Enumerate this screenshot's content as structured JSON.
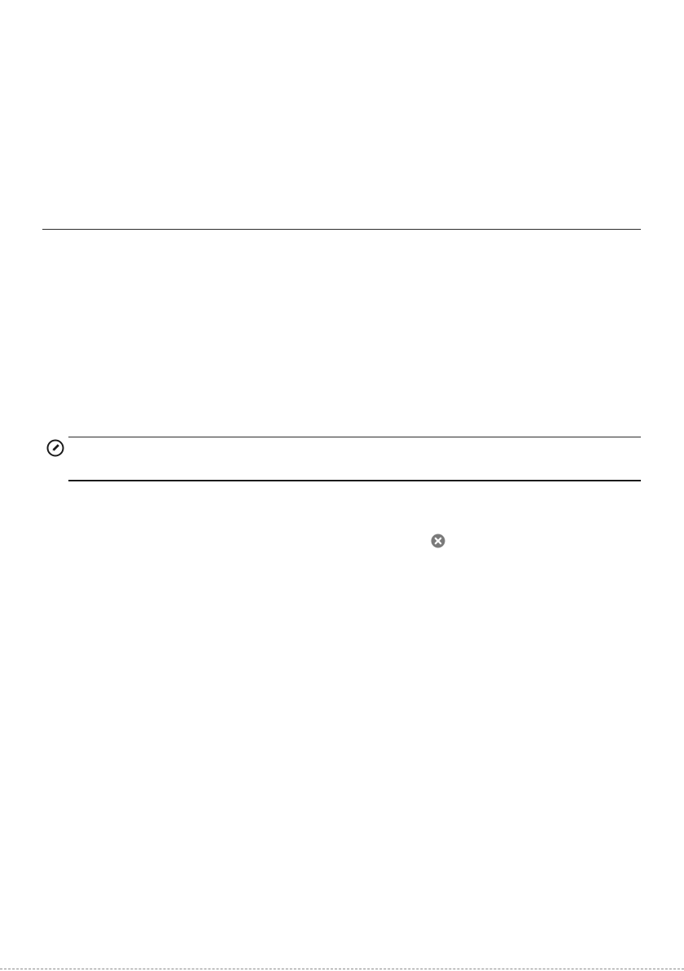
{
  "icons": {
    "note": "pencil-note-icon",
    "close": "close-circle-icon"
  },
  "colors": {
    "rule": "#2b2b2b",
    "icon_dark": "#1a1a1a",
    "icon_gray": "#7a7a7a"
  }
}
